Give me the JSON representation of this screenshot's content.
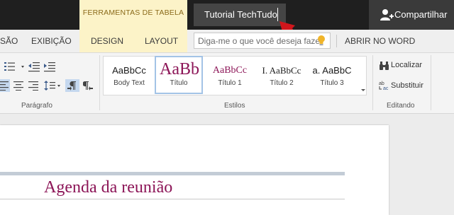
{
  "titlebar": {
    "contextual_tools": "FERRAMENTAS DE TABELA",
    "document_title": "Tutorial TechTudo",
    "share_label": "Compartilhar",
    "colors": {
      "bar": "#1f1f1f",
      "contextual": "#fcf3c8",
      "annotation_arrow": "#d0161c"
    }
  },
  "tabs": {
    "partial_prev": "SÃO",
    "exibicao": "EXIBIÇÃO",
    "design": "DESIGN",
    "layout": "LAYOUT",
    "search_placeholder": "Diga-me o que você deseja fazer",
    "abrir_no_word": "ABRIR NO WORD"
  },
  "ribbon": {
    "paragrafo_label": "Parágrafo",
    "estilos_label": "Estilos",
    "editando_label": "Editando",
    "styles": [
      {
        "sample": "AaBbCc",
        "name": "Body Text"
      },
      {
        "sample": "AaBb",
        "name": "Título"
      },
      {
        "sample": "AaBbCc",
        "name": "Título 1"
      },
      {
        "sample": "I. AaBbCc",
        "name": "Título 2"
      },
      {
        "sample": "a. AaBbC",
        "name": "Título 3"
      }
    ],
    "localizar": "Localizar",
    "substituir": "Substituir"
  },
  "document": {
    "heading": "Agenda da reunião",
    "heading_color": "#8c1557"
  }
}
